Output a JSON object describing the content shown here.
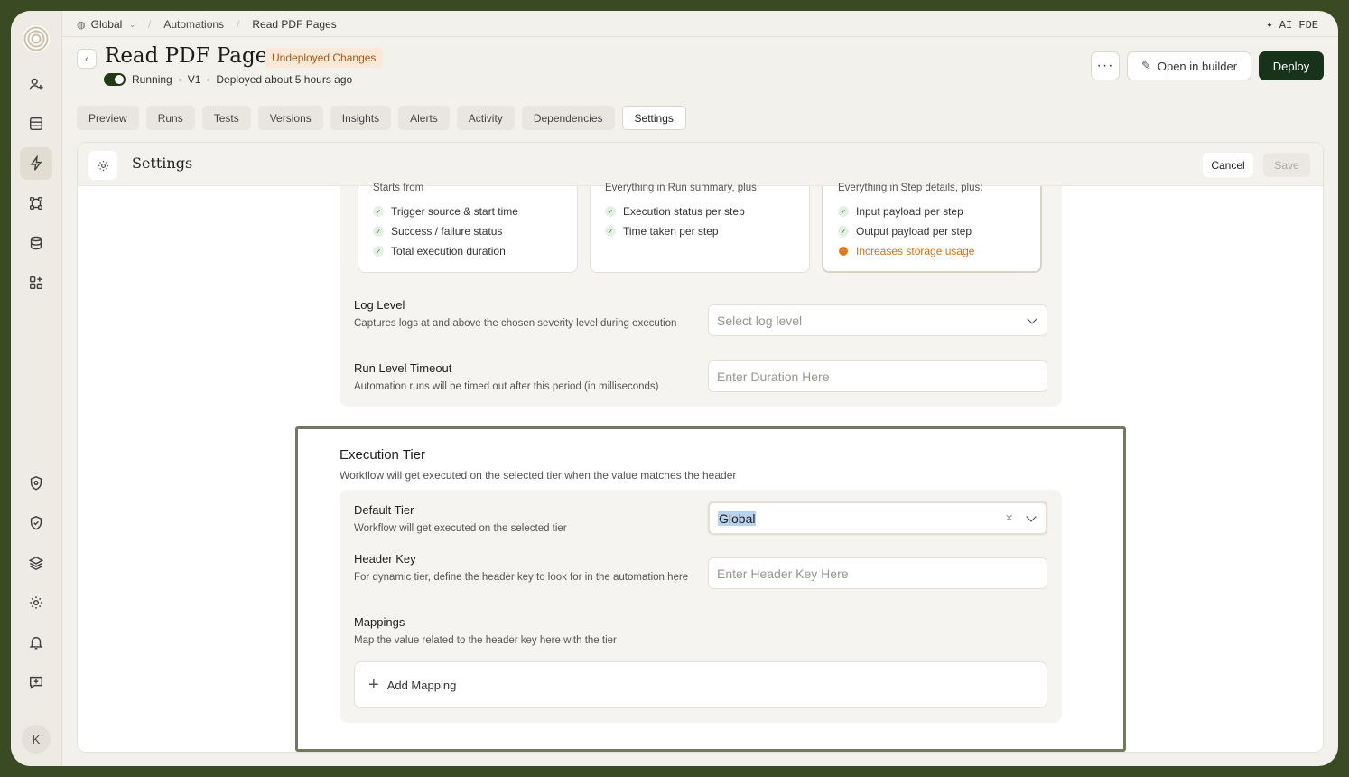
{
  "breadcrumb": {
    "workspace": "Global",
    "section": "Automations",
    "page": "Read PDF Pages"
  },
  "topbar": {
    "ai_label": "✦ AI FDE"
  },
  "header": {
    "title": "Read PDF Pages",
    "badge": "Undeployed Changes",
    "status": "Running",
    "version": "V1",
    "deployed": "Deployed about 5 hours ago",
    "more_label": "···",
    "open_builder": "Open in builder",
    "deploy": "Deploy"
  },
  "tabs": [
    "Preview",
    "Runs",
    "Tests",
    "Versions",
    "Insights",
    "Alerts",
    "Activity",
    "Dependencies",
    "Settings"
  ],
  "active_tab": "Settings",
  "panel": {
    "title": "Settings",
    "cancel": "Cancel",
    "save": "Save"
  },
  "log_cards": [
    {
      "header": "Starts from",
      "items": [
        "Trigger source & start time",
        "Success / failure status",
        "Total execution duration"
      ]
    },
    {
      "header": "Everything in Run summary, plus:",
      "items": [
        "Execution status per step",
        "Time taken per step"
      ]
    },
    {
      "header": "Everything in Step details, plus:",
      "items": [
        "Input payload per step",
        "Output payload per step"
      ],
      "warning": "Increases storage usage"
    }
  ],
  "log_level": {
    "label": "Log Level",
    "desc": "Captures logs at and above the chosen severity level during execution",
    "placeholder": "Select log level"
  },
  "timeout": {
    "label": "Run Level Timeout",
    "desc": "Automation runs will be timed out after this period (in milliseconds)",
    "placeholder": "Enter Duration Here"
  },
  "execution_tier": {
    "title": "Execution Tier",
    "desc": "Workflow will get executed on the selected tier when the value matches the header",
    "default_tier": {
      "label": "Default Tier",
      "desc": "Workflow will get executed on the selected tier",
      "value": "Global"
    },
    "header_key": {
      "label": "Header Key",
      "desc": "For dynamic tier, define the header key to look for in the automation here",
      "placeholder": "Enter Header Key Here"
    },
    "mappings": {
      "label": "Mappings",
      "desc": "Map the value related to the header key here with the tier",
      "add_label": "Add Mapping"
    }
  },
  "user": {
    "initial": "K"
  },
  "colors": {
    "deploy_bg": "#17331a",
    "badge_bg": "#fbe8d6",
    "badge_fg": "#a8561a",
    "warning": "#e07a1f",
    "focus_border": "#6f7a5f"
  }
}
